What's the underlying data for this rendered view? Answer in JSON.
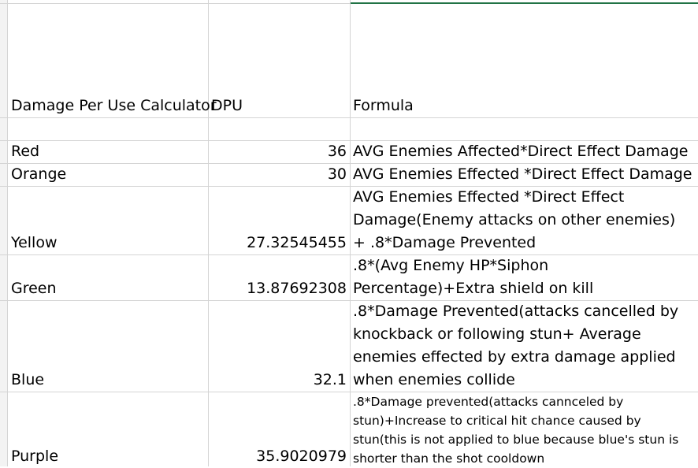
{
  "header": {
    "calculator": "Damage Per Use Calculator",
    "dpu": "DPU",
    "formula": "Formula"
  },
  "rows": [
    {
      "name": "Red",
      "dpu": "36",
      "formula": "AVG Enemies Affected*Direct Effect Damage"
    },
    {
      "name": "Orange",
      "dpu": "30",
      "formula": "AVG Enemies Effected *Direct Effect Damage"
    },
    {
      "name": "Yellow",
      "dpu": "27.32545455",
      "formula": "AVG Enemies Effected *Direct Effect Damage(Enemy attacks on other enemies) + .8*Damage Prevented"
    },
    {
      "name": "Green",
      "dpu": "13.87692308",
      "formula": ".8*(Avg Enemy HP*Siphon Percentage)+Extra shield on kill"
    },
    {
      "name": "Blue",
      "dpu": "32.1",
      "formula": ".8*Damage Prevented(attacks cancelled by knockback or following stun+ Average enemies effected by extra damage applied when enemies collide"
    },
    {
      "name": "Purple",
      "dpu": "35.9020979",
      "formula": ".8*Damage prevented(attacks cannceled by stun)+Increase to critical hit chance caused by stun(this is not applied to blue because blue's stun is shorter than the shot cooldown"
    }
  ]
}
